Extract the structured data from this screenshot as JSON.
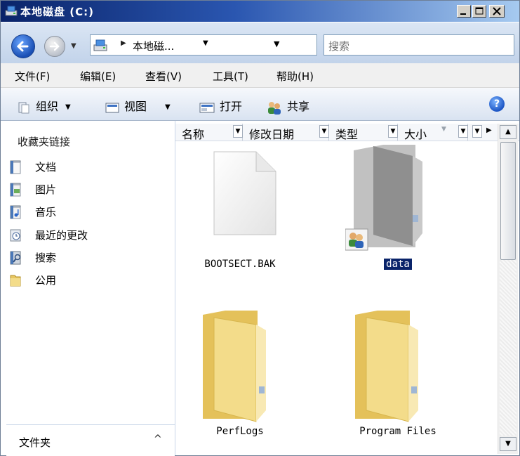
{
  "window": {
    "title": "本地磁盘 (C:)"
  },
  "address": {
    "path_text": "本地磁...",
    "search_placeholder": "搜索"
  },
  "menu": {
    "items": [
      "文件(F)",
      "编辑(E)",
      "查看(V)",
      "工具(T)",
      "帮助(H)"
    ]
  },
  "toolbar": {
    "organize": "组织",
    "views": "视图",
    "open": "打开",
    "share": "共享"
  },
  "favorites": {
    "title": "收藏夹链接",
    "items": [
      {
        "label": "文档",
        "icon": "documents-icon"
      },
      {
        "label": "图片",
        "icon": "pictures-icon"
      },
      {
        "label": "音乐",
        "icon": "music-icon"
      },
      {
        "label": "最近的更改",
        "icon": "recent-changes-icon"
      },
      {
        "label": "搜索",
        "icon": "search-icon"
      },
      {
        "label": "公用",
        "icon": "public-folder-icon"
      }
    ],
    "folders_label": "文件夹"
  },
  "columns": [
    "名称",
    "修改日期",
    "类型",
    "大小"
  ],
  "files": [
    {
      "name": "BOOTSECT.BAK",
      "icon": "file-icon",
      "selected": false
    },
    {
      "name": "data",
      "icon": "shared-folder-icon",
      "selected": true
    },
    {
      "name": "PerfLogs",
      "icon": "folder-icon",
      "selected": false
    },
    {
      "name": "Program Files",
      "icon": "folder-icon",
      "selected": false
    }
  ],
  "colors": {
    "titlebar_start": "#0a246a",
    "titlebar_end": "#a6caf0",
    "selection": "#0a246a",
    "folder": "#f3dc8a"
  }
}
